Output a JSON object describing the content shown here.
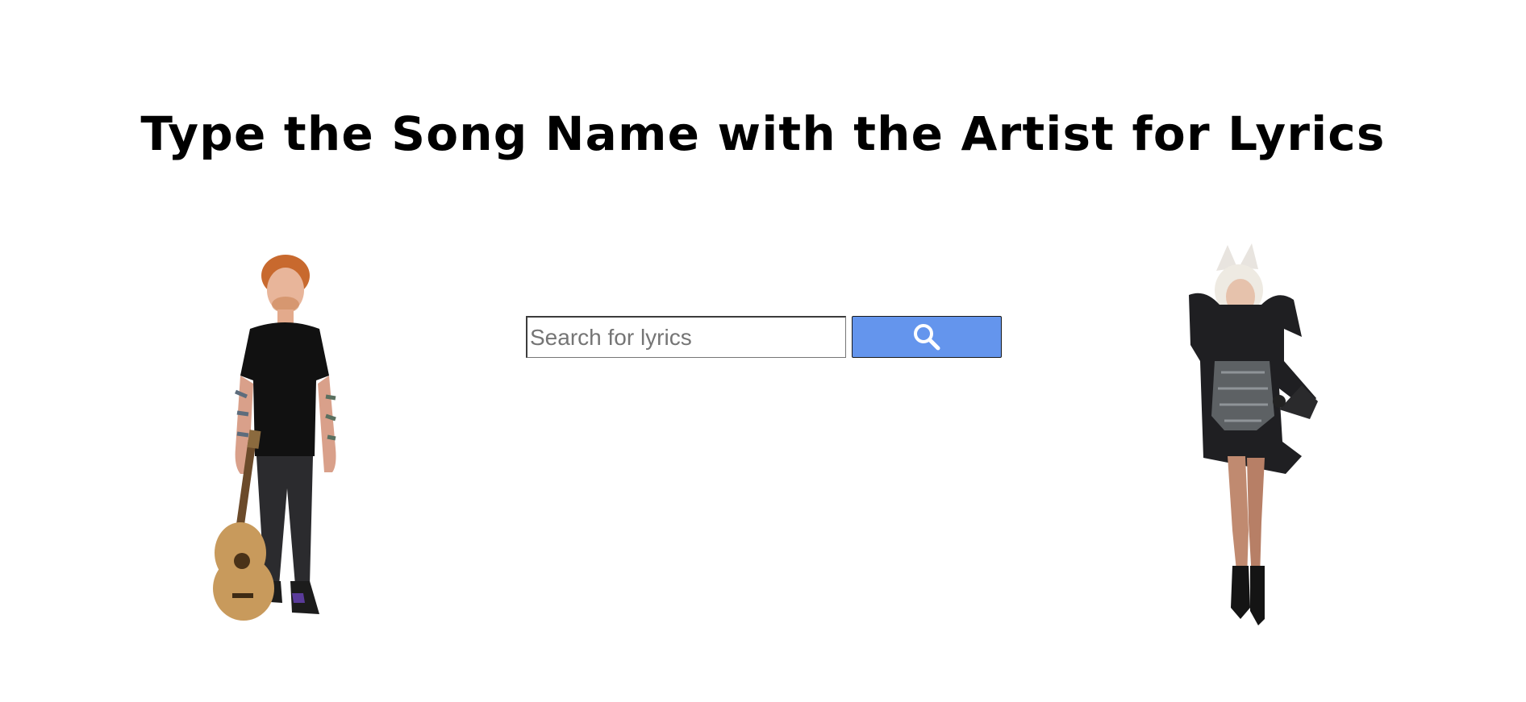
{
  "page": {
    "title": "Type the Song Name with the Artist for Lyrics"
  },
  "search": {
    "placeholder": "Search for lyrics",
    "value": "",
    "button_icon": "search-icon",
    "button_color": "#6495ed"
  },
  "images": {
    "left": "artist-guitar-figure",
    "right": "artist-costume-figure"
  }
}
